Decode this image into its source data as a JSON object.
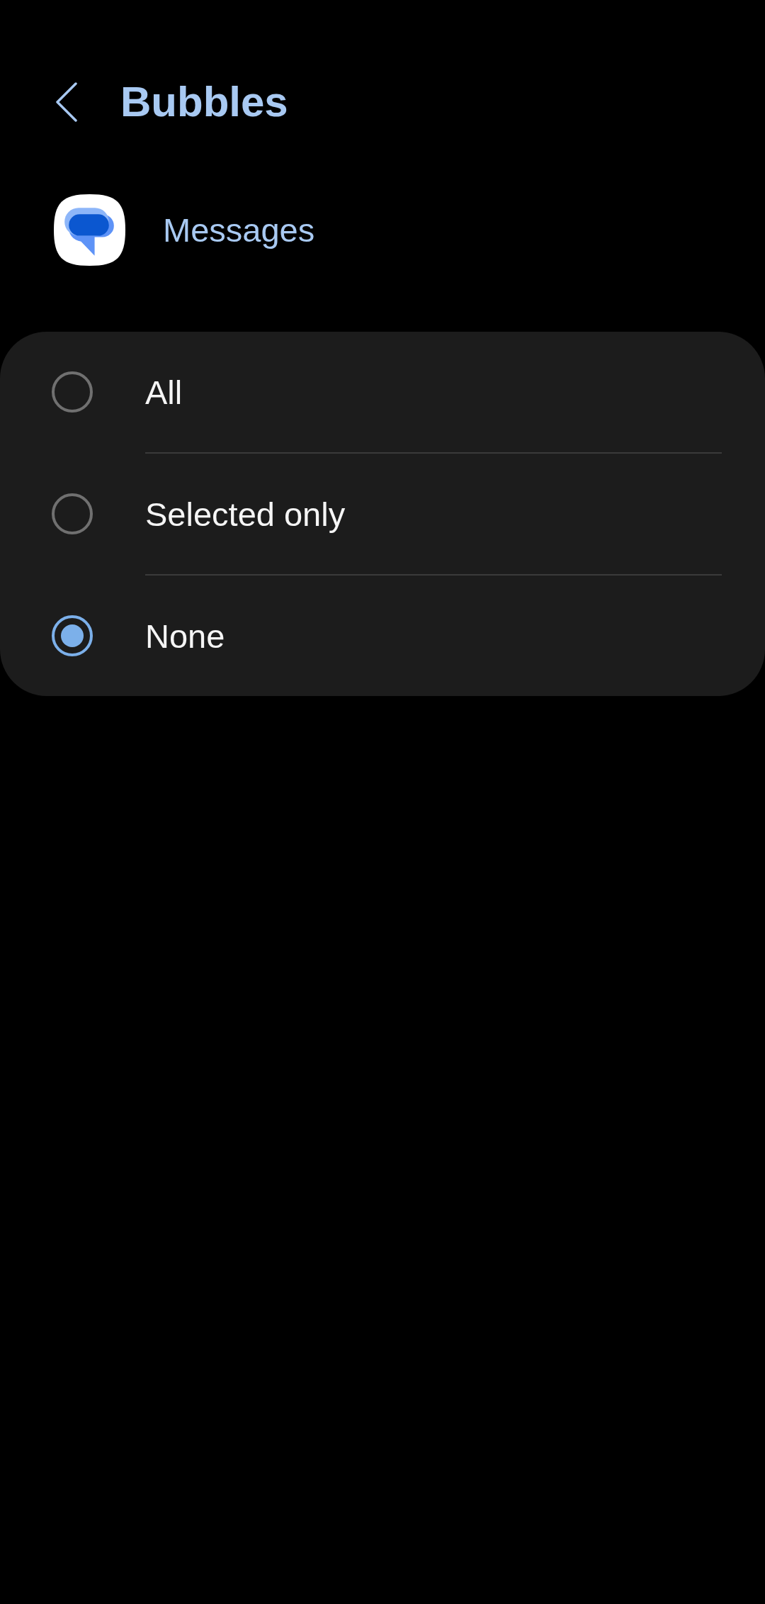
{
  "header": {
    "title": "Bubbles"
  },
  "app": {
    "name": "Messages"
  },
  "options": [
    {
      "label": "All",
      "selected": false
    },
    {
      "label": "Selected only",
      "selected": false
    },
    {
      "label": "None",
      "selected": true
    }
  ]
}
